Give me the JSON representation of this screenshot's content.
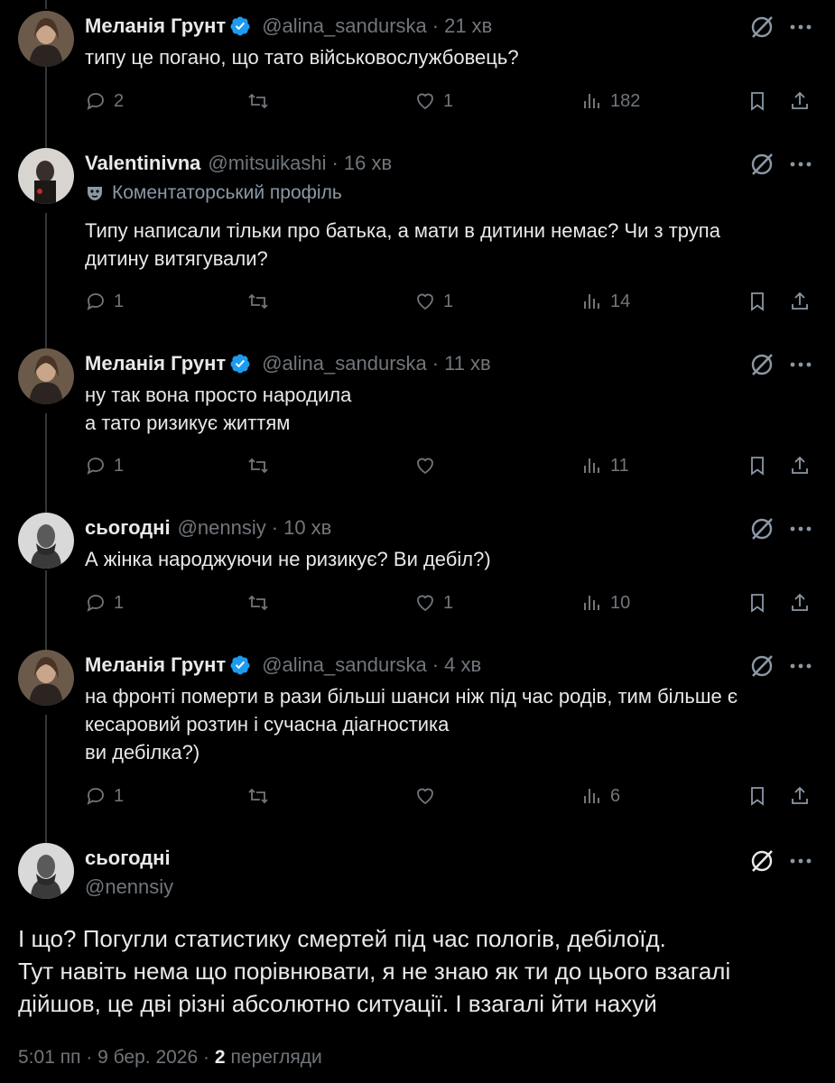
{
  "tweets": [
    {
      "name": "Меланія Грунт",
      "handle": "@alina_sandurska",
      "time": "21 хв",
      "text": "типу це погано, що тато військовослужбовець?",
      "replies": "2",
      "retweets": "",
      "likes": "1",
      "views": "182"
    },
    {
      "name": "Valentinivna",
      "handle": "@mitsuikashi",
      "time": "16 хв",
      "badge": "Коментаторський профіль",
      "text": "Типу написали тільки про батька, а мати в дитини немає? Чи з трупа\nдитину витягували?",
      "replies": "1",
      "retweets": "",
      "likes": "1",
      "views": "14"
    },
    {
      "name": "Меланія Грунт",
      "handle": "@alina_sandurska",
      "time": "11 хв",
      "text": "ну так вона просто народила\nа тато ризикує життям",
      "replies": "1",
      "retweets": "",
      "likes": "",
      "views": "11"
    },
    {
      "name": "сьогодні",
      "handle": "@nennsiy",
      "time": "10 хв",
      "text": "А жінка народжуючи не ризикує? Ви дебіл?)",
      "replies": "1",
      "retweets": "",
      "likes": "1",
      "views": "10"
    },
    {
      "name": "Меланія Грунт",
      "handle": "@alina_sandurska",
      "time": "4 хв",
      "text": "на фронті померти в рази більші шанси ніж під час родів, тим більше є\nкесаровий розтин і сучасна діагностика\nви дебілка?)",
      "replies": "1",
      "retweets": "",
      "likes": "",
      "views": "6"
    }
  ],
  "main": {
    "name": "сьогодні",
    "handle": "@nennsiy",
    "line1": "І що? Погугли статистику смертей під час пологів, дебілоїд.",
    "line2": "Тут навіть нема що порівнювати, я не знаю як ти до цього взагалі",
    "line3": "дійшов, це дві різні абсолютно ситуації. І взагалі йти нахуй",
    "timestamp": "5:01 пп · 9 бер. 2026 · ",
    "views_count": "2",
    "views_label": "перегляди"
  },
  "colors": {
    "background": "#000000",
    "text": "#e7e9ea",
    "muted": "#71767b",
    "verified": "#1d9bf0"
  },
  "icons": [
    "verified-badge-icon",
    "grok-icon",
    "more-icon",
    "reply-icon",
    "retweet-icon",
    "like-icon",
    "views-icon",
    "bookmark-icon",
    "share-icon",
    "mask-icon"
  ]
}
